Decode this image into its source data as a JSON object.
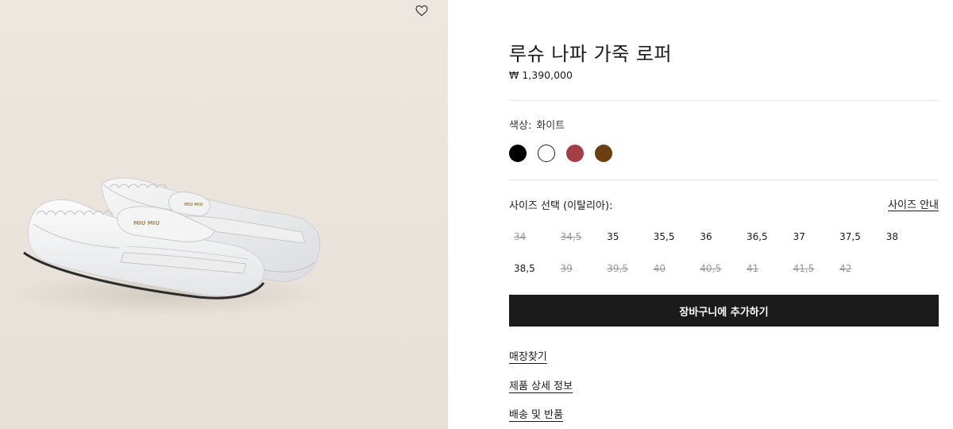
{
  "product": {
    "title": "루슈 나파 가죽 로퍼",
    "price": "₩ 1,390,000"
  },
  "color": {
    "label": "색상:",
    "selected_name": "화이트",
    "swatches": [
      {
        "name": "black",
        "hex": "#000000",
        "selected": false
      },
      {
        "name": "white",
        "hex": "#ffffff",
        "selected": true
      },
      {
        "name": "red",
        "hex": "#a23e45",
        "selected": false
      },
      {
        "name": "brown",
        "hex": "#6b3f12",
        "selected": false
      }
    ]
  },
  "size": {
    "label": "사이즈 선택 (이탈리아):",
    "guide_link": "사이즈 안내",
    "options": [
      {
        "value": "34",
        "available": false
      },
      {
        "value": "34,5",
        "available": false
      },
      {
        "value": "35",
        "available": true
      },
      {
        "value": "35,5",
        "available": true
      },
      {
        "value": "36",
        "available": true
      },
      {
        "value": "36,5",
        "available": true
      },
      {
        "value": "37",
        "available": true
      },
      {
        "value": "37,5",
        "available": true
      },
      {
        "value": "38",
        "available": true
      },
      {
        "value": "38,5",
        "available": true
      },
      {
        "value": "39",
        "available": false
      },
      {
        "value": "39,5",
        "available": false
      },
      {
        "value": "40",
        "available": false
      },
      {
        "value": "40,5",
        "available": false
      },
      {
        "value": "41",
        "available": false
      },
      {
        "value": "41,5",
        "available": false
      },
      {
        "value": "42",
        "available": false
      }
    ]
  },
  "actions": {
    "add_to_cart": "장바구니에 추가하기"
  },
  "links": {
    "find_store": "매장찾기",
    "product_details": "제품 상세 정보",
    "shipping_returns": "배송 및 반품"
  },
  "image": {
    "wishlist_icon": "heart-icon",
    "logo_text": "miu miu"
  }
}
